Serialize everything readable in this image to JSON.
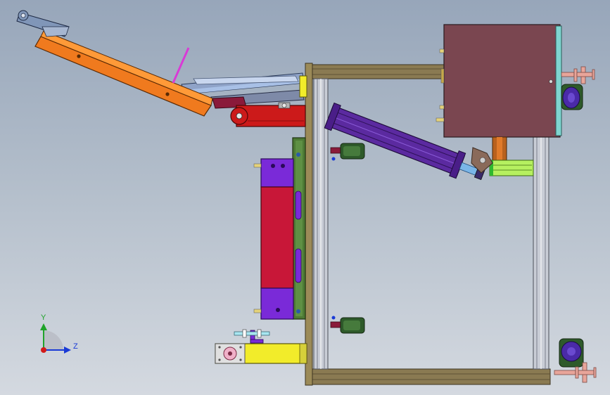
{
  "viewport": {
    "name": "cad-graphics-area",
    "background_top": "#97a6ba",
    "background_bottom": "#d4d9e0"
  },
  "triad": {
    "y_label": "Y",
    "z_label": "Z",
    "y_color": "#1fa32a",
    "z_color": "#1a3ad6",
    "origin_color": "#d21a1a"
  },
  "assembly": {
    "colors": {
      "frame_bronze": "#8a7a52",
      "frame_bronze_dark": "#5e5235",
      "aluminum_post": "#c9cdd6",
      "lever_orange": "#f07a1e",
      "lever_orange_light": "#ff9a38",
      "red_arm": "#cc1a1a",
      "purple_cylinder": "#5b2aa0",
      "housing": "#7a4650",
      "plate_green": "#4d7a35",
      "crimson_block": "#c81738",
      "violet_block": "#7a2ad8",
      "yellow_block": "#f2ec2a",
      "peach_foot": "#e8a59a",
      "dark_green": "#2e5a2a",
      "pink_rod": "#d93ad6"
    }
  }
}
